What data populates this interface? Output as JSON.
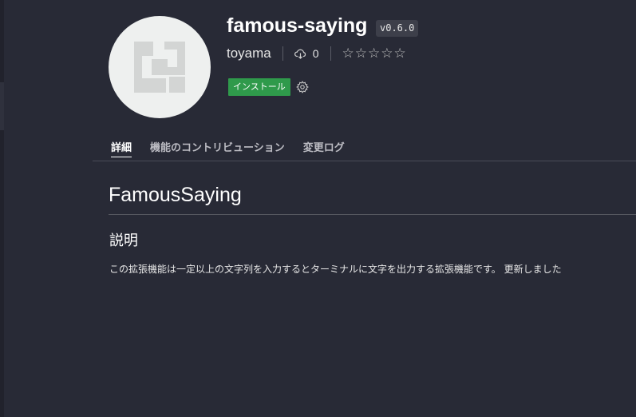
{
  "extension": {
    "name": "famous-saying",
    "version": "v0.6.0",
    "publisher": "toyama",
    "install_count": "0",
    "rating_stars": "☆☆☆☆☆",
    "install_label": "インストール"
  },
  "tabs": [
    {
      "label": "詳細",
      "active": true
    },
    {
      "label": "機能のコントリビューション",
      "active": false
    },
    {
      "label": "変更ログ",
      "active": false
    }
  ],
  "readme": {
    "title": "FamousSaying",
    "section_heading": "説明",
    "description": "この拡張機能は一定以上の文字列を入力するとターミナルに文字を出力する拡張機能です。 更新しました"
  },
  "colors": {
    "background": "#282a36",
    "install_button": "#2f9a4b",
    "icon_background": "#eef0ef",
    "icon_glyph": "#d3d5d4"
  },
  "icons": {
    "extension_logo": "extension-placeholder-icon",
    "installs": "cloud-download-icon",
    "settings": "gear-icon"
  }
}
